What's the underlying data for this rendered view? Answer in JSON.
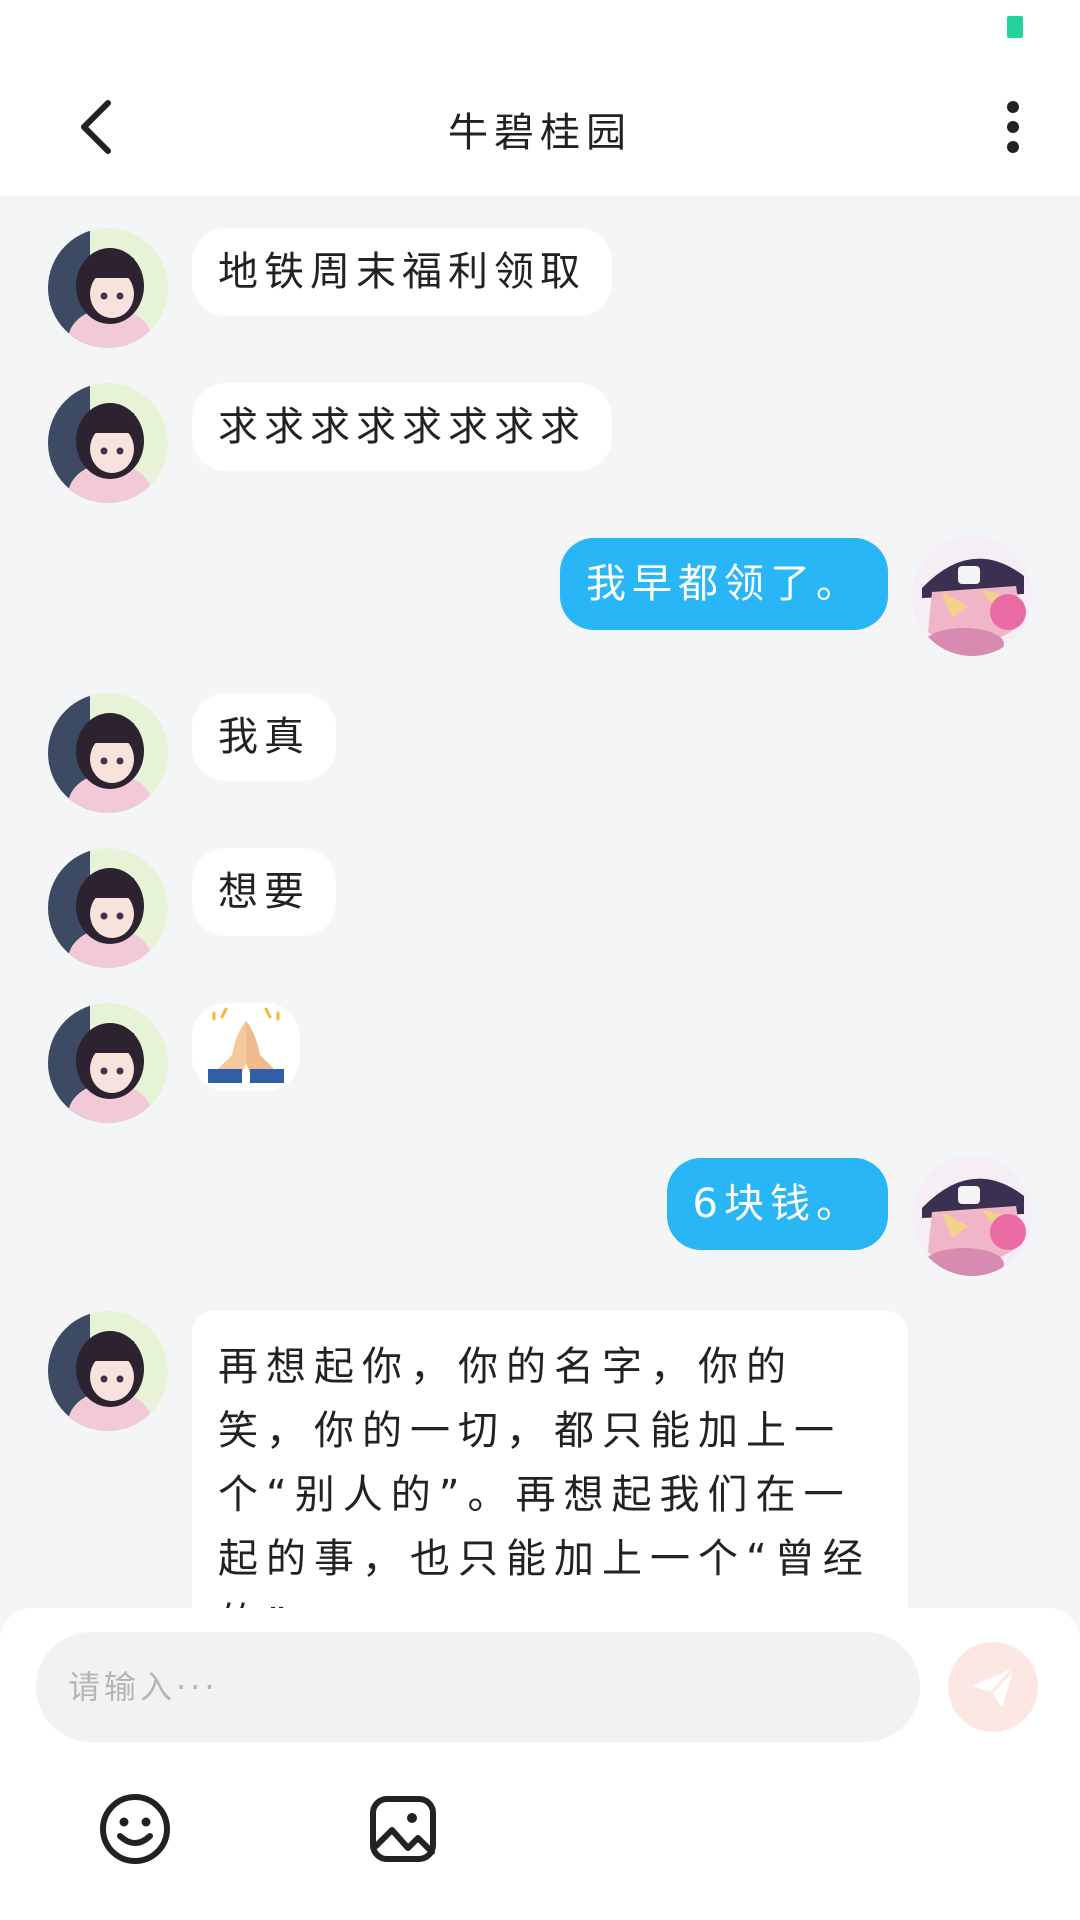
{
  "header": {
    "title": "牛碧桂园"
  },
  "colors": {
    "accent_blue": "#29b6f6",
    "background": "#f4f5f7",
    "status_green": "#22d39b"
  },
  "messages": [
    {
      "side": "in",
      "text": "地铁周末福利领取"
    },
    {
      "side": "in",
      "text": "求求求求求求求求"
    },
    {
      "side": "out",
      "text": "我早都领了。"
    },
    {
      "side": "in",
      "text": "我真"
    },
    {
      "side": "in",
      "text": "想要"
    },
    {
      "side": "in",
      "text": "🙏"
    },
    {
      "side": "out",
      "text": "6块钱。"
    },
    {
      "side": "in",
      "text": "再想起你，你的名字，你的笑，你的一切，都只能加上一个“别人的”。再想起我们在一起的事，也只能加上一个“曾经的”"
    }
  ],
  "composer": {
    "placeholder": "请输入···"
  },
  "icons": {
    "back": "chevron-left-icon",
    "more": "more-vertical-icon",
    "send": "send-icon",
    "emoji": "smiley-icon",
    "image": "image-icon"
  }
}
